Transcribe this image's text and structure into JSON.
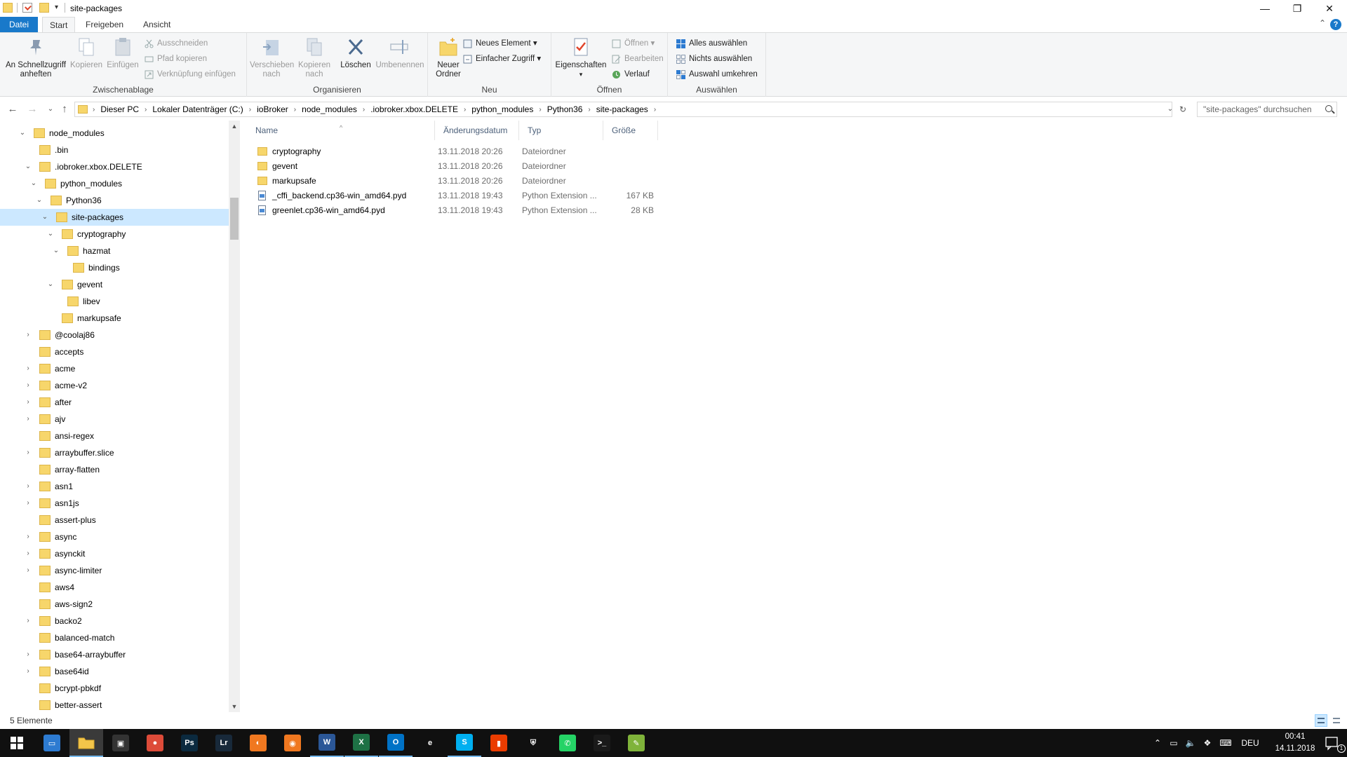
{
  "window": {
    "title": "site-packages",
    "minimize_glyph": "—",
    "maximize_glyph": "❐",
    "close_glyph": "✕"
  },
  "ribbon_tabs": [
    "Datei",
    "Start",
    "Freigeben",
    "Ansicht"
  ],
  "ribbon": {
    "clipboard": {
      "label": "Zwischenablage",
      "pin": "An Schnellzugriff anheften",
      "copy": "Kopieren",
      "paste": "Einfügen",
      "cut": "Ausschneiden",
      "copy_path": "Pfad kopieren",
      "paste_shortcut": "Verknüpfung einfügen"
    },
    "organize": {
      "label": "Organisieren",
      "move_to": "Verschieben nach",
      "copy_to": "Kopieren nach",
      "delete": "Löschen",
      "rename": "Umbenennen"
    },
    "new": {
      "label": "Neu",
      "new_folder": "Neuer Ordner",
      "new_item": "Neues Element",
      "easy_access": "Einfacher Zugriff"
    },
    "open": {
      "label": "Öffnen",
      "properties": "Eigenschaften",
      "open": "Öffnen",
      "edit": "Bearbeiten",
      "history": "Verlauf"
    },
    "select": {
      "label": "Auswählen",
      "select_all": "Alles auswählen",
      "select_none": "Nichts auswählen",
      "invert": "Auswahl umkehren"
    }
  },
  "address": {
    "segments": [
      "Dieser PC",
      "Lokaler Datenträger (C:)",
      "ioBroker",
      "node_modules",
      ".iobroker.xbox.DELETE",
      "python_modules",
      "Python36",
      "site-packages"
    ],
    "search_placeholder": "\"site-packages\" durchsuchen"
  },
  "nav_tree": [
    {
      "label": "node_modules",
      "depth": 0,
      "exp": "open"
    },
    {
      "label": ".bin",
      "depth": 1,
      "exp": "none"
    },
    {
      "label": ".iobroker.xbox.DELETE",
      "depth": 1,
      "exp": "open"
    },
    {
      "label": "python_modules",
      "depth": 2,
      "exp": "open"
    },
    {
      "label": "Python36",
      "depth": 3,
      "exp": "open"
    },
    {
      "label": "site-packages",
      "depth": 4,
      "exp": "open",
      "selected": true
    },
    {
      "label": "cryptography",
      "depth": 5,
      "exp": "open"
    },
    {
      "label": "hazmat",
      "depth": 6,
      "exp": "open"
    },
    {
      "label": "bindings",
      "depth": 7,
      "exp": "none"
    },
    {
      "label": "gevent",
      "depth": 5,
      "exp": "open"
    },
    {
      "label": "libev",
      "depth": 6,
      "exp": "none"
    },
    {
      "label": "markupsafe",
      "depth": 5,
      "exp": "none"
    },
    {
      "label": "@coolaj86",
      "depth": 1,
      "exp": "closed"
    },
    {
      "label": "accepts",
      "depth": 1,
      "exp": "none"
    },
    {
      "label": "acme",
      "depth": 1,
      "exp": "closed"
    },
    {
      "label": "acme-v2",
      "depth": 1,
      "exp": "closed"
    },
    {
      "label": "after",
      "depth": 1,
      "exp": "closed"
    },
    {
      "label": "ajv",
      "depth": 1,
      "exp": "closed"
    },
    {
      "label": "ansi-regex",
      "depth": 1,
      "exp": "none"
    },
    {
      "label": "arraybuffer.slice",
      "depth": 1,
      "exp": "closed"
    },
    {
      "label": "array-flatten",
      "depth": 1,
      "exp": "none"
    },
    {
      "label": "asn1",
      "depth": 1,
      "exp": "closed"
    },
    {
      "label": "asn1js",
      "depth": 1,
      "exp": "closed"
    },
    {
      "label": "assert-plus",
      "depth": 1,
      "exp": "none"
    },
    {
      "label": "async",
      "depth": 1,
      "exp": "closed"
    },
    {
      "label": "asynckit",
      "depth": 1,
      "exp": "closed"
    },
    {
      "label": "async-limiter",
      "depth": 1,
      "exp": "closed"
    },
    {
      "label": "aws4",
      "depth": 1,
      "exp": "none"
    },
    {
      "label": "aws-sign2",
      "depth": 1,
      "exp": "none"
    },
    {
      "label": "backo2",
      "depth": 1,
      "exp": "closed"
    },
    {
      "label": "balanced-match",
      "depth": 1,
      "exp": "none"
    },
    {
      "label": "base64-arraybuffer",
      "depth": 1,
      "exp": "closed"
    },
    {
      "label": "base64id",
      "depth": 1,
      "exp": "closed"
    },
    {
      "label": "bcrypt-pbkdf",
      "depth": 1,
      "exp": "none"
    },
    {
      "label": "better-assert",
      "depth": 1,
      "exp": "none"
    }
  ],
  "file_columns": [
    "Name",
    "Änderungsdatum",
    "Typ",
    "Größe"
  ],
  "files": [
    {
      "name": "cryptography",
      "date": "13.11.2018 20:26",
      "type": "Dateiordner",
      "size": "",
      "kind": "folder"
    },
    {
      "name": "gevent",
      "date": "13.11.2018 20:26",
      "type": "Dateiordner",
      "size": "",
      "kind": "folder"
    },
    {
      "name": "markupsafe",
      "date": "13.11.2018 20:26",
      "type": "Dateiordner",
      "size": "",
      "kind": "folder"
    },
    {
      "name": "_cffi_backend.cp36-win_amd64.pyd",
      "date": "13.11.2018 19:43",
      "type": "Python Extension ...",
      "size": "167 KB",
      "kind": "file"
    },
    {
      "name": "greenlet.cp36-win_amd64.pyd",
      "date": "13.11.2018 19:43",
      "type": "Python Extension ...",
      "size": "28 KB",
      "kind": "file"
    }
  ],
  "status": {
    "text": "5 Elemente"
  },
  "taskbar": {
    "apps": [
      {
        "name": "task-view-icon",
        "glyph": "▭",
        "color": "#2d7bd1"
      },
      {
        "name": "file-explorer-icon",
        "glyph": "",
        "color": "#f3c54a",
        "state": "active"
      },
      {
        "name": "store-icon",
        "glyph": "▣",
        "color": "#333333"
      },
      {
        "name": "chrome-icon",
        "glyph": "●",
        "color": "#dd4b39"
      },
      {
        "name": "photoshop-icon",
        "glyph": "Ps",
        "color": "#0b2a3f"
      },
      {
        "name": "lightroom-icon",
        "glyph": "Lr",
        "color": "#18293a"
      },
      {
        "name": "avast-icon",
        "glyph": "◐",
        "color": "#f07820"
      },
      {
        "name": "avast-secureline-icon",
        "glyph": "◉",
        "color": "#f07820"
      },
      {
        "name": "word-icon",
        "glyph": "W",
        "color": "#2b5797",
        "state": "running"
      },
      {
        "name": "excel-icon",
        "glyph": "X",
        "color": "#1e7145",
        "state": "running"
      },
      {
        "name": "outlook-icon",
        "glyph": "O",
        "color": "#0072c6",
        "state": "running"
      },
      {
        "name": "edge-icon",
        "glyph": "e",
        "color": "#101010"
      },
      {
        "name": "skype-icon",
        "glyph": "S",
        "color": "#00aff0",
        "state": "running"
      },
      {
        "name": "office-icon",
        "glyph": "▮",
        "color": "#eb3c00"
      },
      {
        "name": "security-icon",
        "glyph": "⛨",
        "color": "#101010"
      },
      {
        "name": "whatsapp-icon",
        "glyph": "✆",
        "color": "#25d366"
      },
      {
        "name": "terminal-icon",
        "glyph": ">_",
        "color": "#1a1a1a"
      },
      {
        "name": "notepad-icon",
        "glyph": "✎",
        "color": "#7fb33a"
      }
    ],
    "language": "DEU",
    "time": "00:41",
    "date": "14.11.2018",
    "notifications": "1"
  },
  "colors": {
    "accent": "#1979ca",
    "selection": "#cce8ff",
    "folder": "#f7d66b",
    "taskbar": "#101010"
  }
}
